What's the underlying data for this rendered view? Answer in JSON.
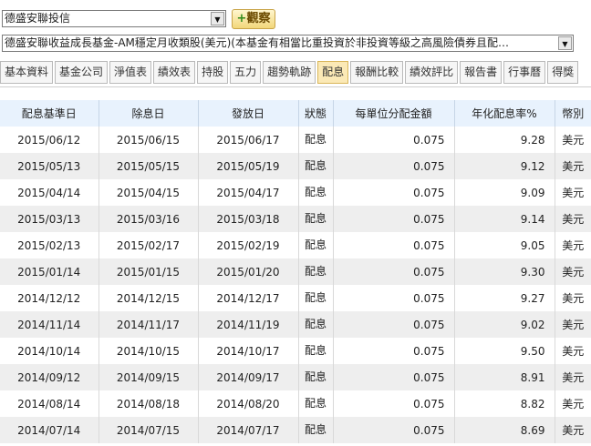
{
  "company_select": {
    "value": "德盛安聯投信"
  },
  "watch_button": {
    "label": "觀察",
    "plus": "+"
  },
  "fund_select": {
    "value": "德盛安聯收益成長基金-AM穩定月收類股(美元)(本基金有相當比重投資於非投資等級之高風險債券且配…"
  },
  "tabs": [
    {
      "label": "基本資料",
      "active": false
    },
    {
      "label": "基金公司",
      "active": false
    },
    {
      "label": "淨值表",
      "active": false
    },
    {
      "label": "績效表",
      "active": false
    },
    {
      "label": "持股",
      "active": false
    },
    {
      "label": "五力",
      "active": false
    },
    {
      "label": "趨勢軌跡",
      "active": false
    },
    {
      "label": "配息",
      "active": true
    },
    {
      "label": "報酬比較",
      "active": false
    },
    {
      "label": "績效評比",
      "active": false
    },
    {
      "label": "報告書",
      "active": false
    },
    {
      "label": "行事曆",
      "active": false
    },
    {
      "label": "得獎",
      "active": false
    }
  ],
  "table": {
    "headers": [
      "配息基準日",
      "除息日",
      "發放日",
      "狀態",
      "每單位分配金額",
      "年化配息率%",
      "幣別"
    ],
    "rows": [
      [
        "2015/06/12",
        "2015/06/15",
        "2015/06/17",
        "配息",
        "0.075",
        "9.28",
        "美元"
      ],
      [
        "2015/05/13",
        "2015/05/15",
        "2015/05/19",
        "配息",
        "0.075",
        "9.12",
        "美元"
      ],
      [
        "2015/04/14",
        "2015/04/15",
        "2015/04/17",
        "配息",
        "0.075",
        "9.09",
        "美元"
      ],
      [
        "2015/03/13",
        "2015/03/16",
        "2015/03/18",
        "配息",
        "0.075",
        "9.14",
        "美元"
      ],
      [
        "2015/02/13",
        "2015/02/17",
        "2015/02/19",
        "配息",
        "0.075",
        "9.05",
        "美元"
      ],
      [
        "2015/01/14",
        "2015/01/15",
        "2015/01/20",
        "配息",
        "0.075",
        "9.30",
        "美元"
      ],
      [
        "2014/12/12",
        "2014/12/15",
        "2014/12/17",
        "配息",
        "0.075",
        "9.27",
        "美元"
      ],
      [
        "2014/11/14",
        "2014/11/17",
        "2014/11/19",
        "配息",
        "0.075",
        "9.02",
        "美元"
      ],
      [
        "2014/10/14",
        "2014/10/15",
        "2014/10/17",
        "配息",
        "0.075",
        "9.50",
        "美元"
      ],
      [
        "2014/09/12",
        "2014/09/15",
        "2014/09/17",
        "配息",
        "0.075",
        "8.91",
        "美元"
      ],
      [
        "2014/08/14",
        "2014/08/18",
        "2014/08/20",
        "配息",
        "0.075",
        "8.82",
        "美元"
      ],
      [
        "2014/07/14",
        "2014/07/15",
        "2014/07/17",
        "配息",
        "0.075",
        "8.69",
        "美元"
      ]
    ]
  },
  "colors": {
    "header_bg": "#e8f2fd",
    "row_even_bg": "#eeeeee",
    "active_tab_bg": "#fbe9b6",
    "watch_button_bg": "#f2d77a"
  }
}
